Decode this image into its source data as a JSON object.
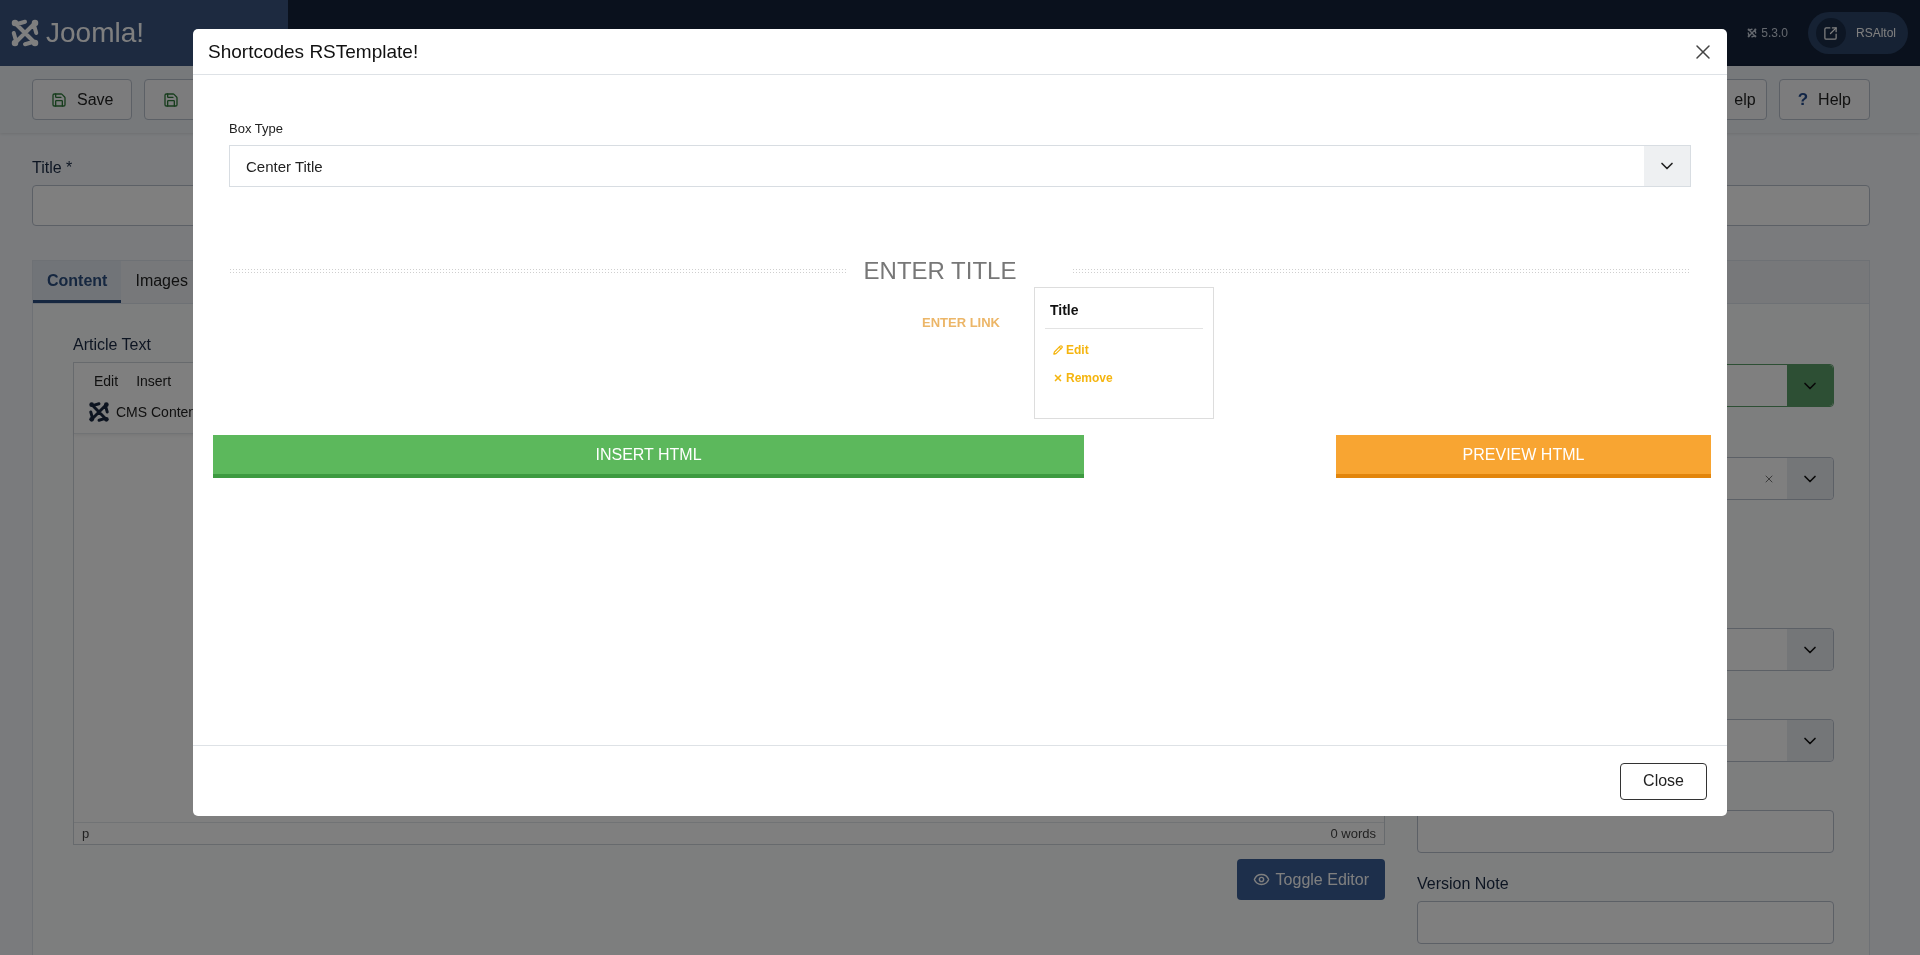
{
  "header": {
    "logo": "Joomla!",
    "version": "5.3.0",
    "user": "RSAltol"
  },
  "toolbar": {
    "left": [
      {
        "kind": "save",
        "label": "Save"
      },
      {
        "kind": "save-icon"
      }
    ],
    "right": [
      {
        "kind": "text",
        "label": "elp"
      },
      {
        "kind": "help",
        "icon": "?",
        "label": "Help"
      }
    ]
  },
  "form": {
    "title_label": "Title *",
    "tabs": [
      {
        "label": "Content",
        "selected": true
      },
      {
        "label": "Images",
        "selected": false
      }
    ],
    "editor": {
      "label": "Article Text",
      "menu": [
        "Edit",
        "Insert"
      ],
      "plugin": "CMS Conten",
      "path": "p",
      "word_count": "0 words",
      "toggle": "Toggle Editor"
    },
    "side_fields": [
      {
        "kind": "select-valid"
      },
      {
        "kind": "select-clear"
      },
      {
        "kind": "select"
      },
      {
        "kind": "select"
      },
      {
        "kind": "input"
      },
      {
        "kind": "input",
        "label": "Version Note"
      }
    ]
  },
  "modal": {
    "title": "Shortcodes RSTemplate!",
    "box_type_label": "Box Type",
    "box_type_value": "Center Title",
    "preview": {
      "title": "ENTER TITLE",
      "link": "ENTER LINK"
    },
    "popover": {
      "heading": "Title",
      "actions": [
        {
          "kind": "edit",
          "label": "Edit"
        },
        {
          "kind": "remove",
          "label": "Remove"
        }
      ]
    },
    "insert_button": "INSERT HTML",
    "preview_button": "PREVIEW HTML",
    "close_button": "Close"
  }
}
